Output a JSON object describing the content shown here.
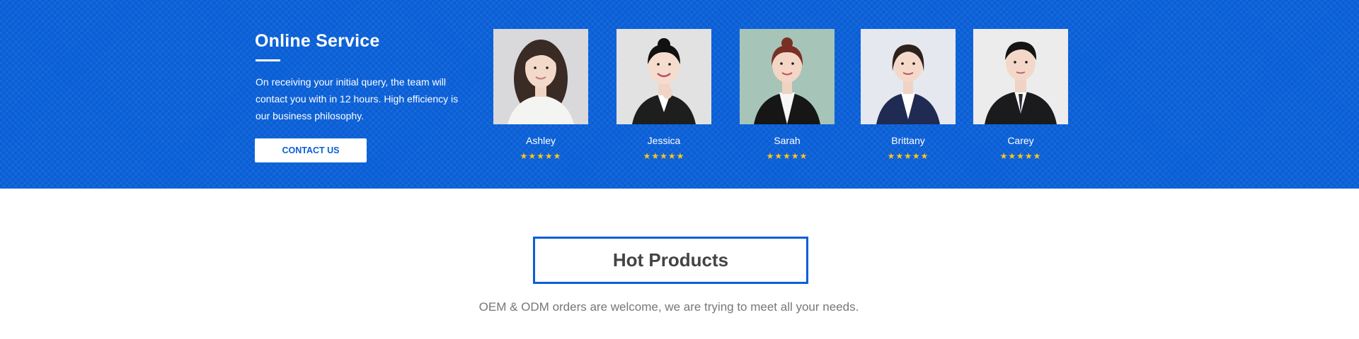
{
  "service": {
    "title": "Online Service",
    "description": "On receiving your initial query, the team will contact you with in 12 hours. High efficiency is our business philosophy.",
    "contact_label": "CONTACT US",
    "agents": [
      {
        "name": "Ashley",
        "stars": "★★★★★",
        "rating": 5
      },
      {
        "name": "Jessica",
        "stars": "★★★★★",
        "rating": 5
      },
      {
        "name": "Sarah",
        "stars": "★★★★★",
        "rating": 5
      },
      {
        "name": "Brittany",
        "stars": "★★★★★",
        "rating": 5
      },
      {
        "name": "Carey",
        "stars": "★★★★★",
        "rating": 5
      }
    ]
  },
  "hot_products": {
    "title": "Hot Products",
    "subtitle": "OEM & ODM orders are welcome, we are trying to meet all your needs."
  },
  "colors": {
    "accent": "#0a5fd6",
    "star": "#ffc61a"
  }
}
